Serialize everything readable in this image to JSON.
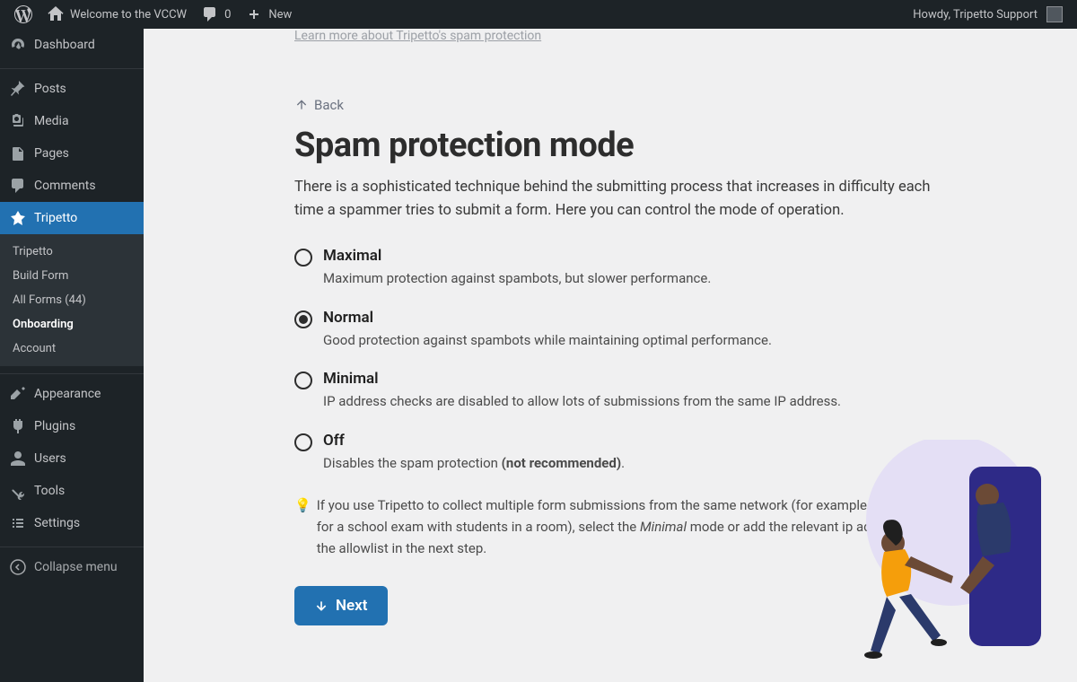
{
  "toolbar": {
    "site_title": "Welcome to the VCCW",
    "comments_count": "0",
    "new_label": "New",
    "howdy": "Howdy, Tripetto Support"
  },
  "sidebar": {
    "dashboard": "Dashboard",
    "posts": "Posts",
    "media": "Media",
    "pages": "Pages",
    "comments": "Comments",
    "tripetto": "Tripetto",
    "appearance": "Appearance",
    "plugins": "Plugins",
    "users": "Users",
    "tools": "Tools",
    "settings": "Settings",
    "collapse": "Collapse menu",
    "sub": {
      "tripetto": "Tripetto",
      "build_form": "Build Form",
      "all_forms": "All Forms (44)",
      "onboarding": "Onboarding",
      "account": "Account"
    }
  },
  "main": {
    "learn_more": "Learn more about Tripetto's spam protection",
    "back": "Back",
    "title": "Spam protection mode",
    "description": "There is a sophisticated technique behind the submitting process that increases in difficulty each time a spammer tries to submit a form. Here you can control the mode of operation.",
    "options": [
      {
        "title": "Maximal",
        "desc": "Maximum protection against spambots, but slower performance.",
        "checked": false
      },
      {
        "title": "Normal",
        "desc": "Good protection against spambots while maintaining optimal performance.",
        "checked": true
      },
      {
        "title": "Minimal",
        "desc": "IP address checks are disabled to allow lots of submissions from the same IP address.",
        "checked": false
      },
      {
        "title": "Off",
        "desc_pre": "Disables the spam protection ",
        "desc_strong": "(not recommended)",
        "desc_post": ".",
        "checked": false
      }
    ],
    "tip_icon": "💡",
    "tip_pre": "If you use Tripetto to collect multiple form submissions from the same network (for example when used for a school exam with students in a room), select the ",
    "tip_em": "Minimal",
    "tip_post": " mode or add the relevant ip addresses to the allowlist in the next step.",
    "next": "Next"
  }
}
